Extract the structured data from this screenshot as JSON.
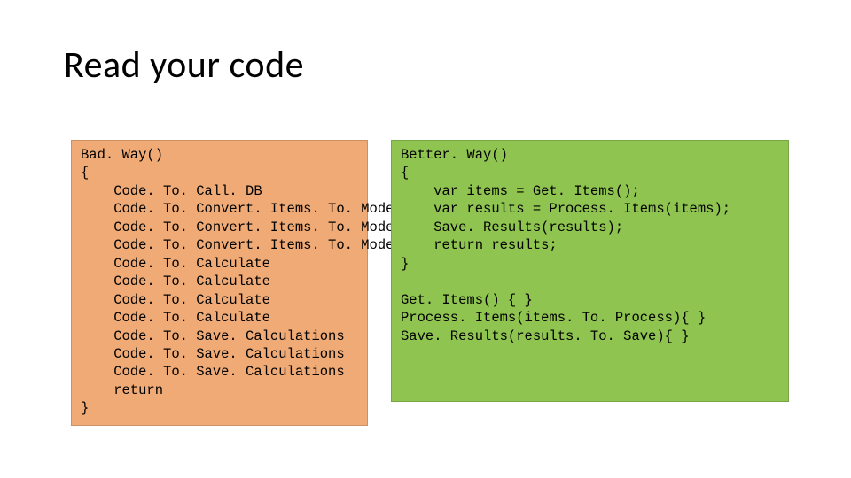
{
  "title": "Read your code",
  "bad": {
    "lines": [
      "Bad. Way()",
      "{",
      "    Code. To. Call. DB",
      "    Code. To. Convert. Items. To. Model",
      "    Code. To. Convert. Items. To. Model",
      "    Code. To. Convert. Items. To. Model",
      "    Code. To. Calculate",
      "    Code. To. Calculate",
      "    Code. To. Calculate",
      "    Code. To. Calculate",
      "    Code. To. Save. Calculations",
      "    Code. To. Save. Calculations",
      "    Code. To. Save. Calculations",
      "    return",
      "}"
    ]
  },
  "good": {
    "lines": [
      "Better. Way()",
      "{",
      "    var items = Get. Items();",
      "    var results = Process. Items(items);",
      "    Save. Results(results);",
      "    return results;",
      "}",
      "",
      "Get. Items() { }",
      "Process. Items(items. To. Process){ }",
      "Save. Results(results. To. Save){ }"
    ]
  }
}
